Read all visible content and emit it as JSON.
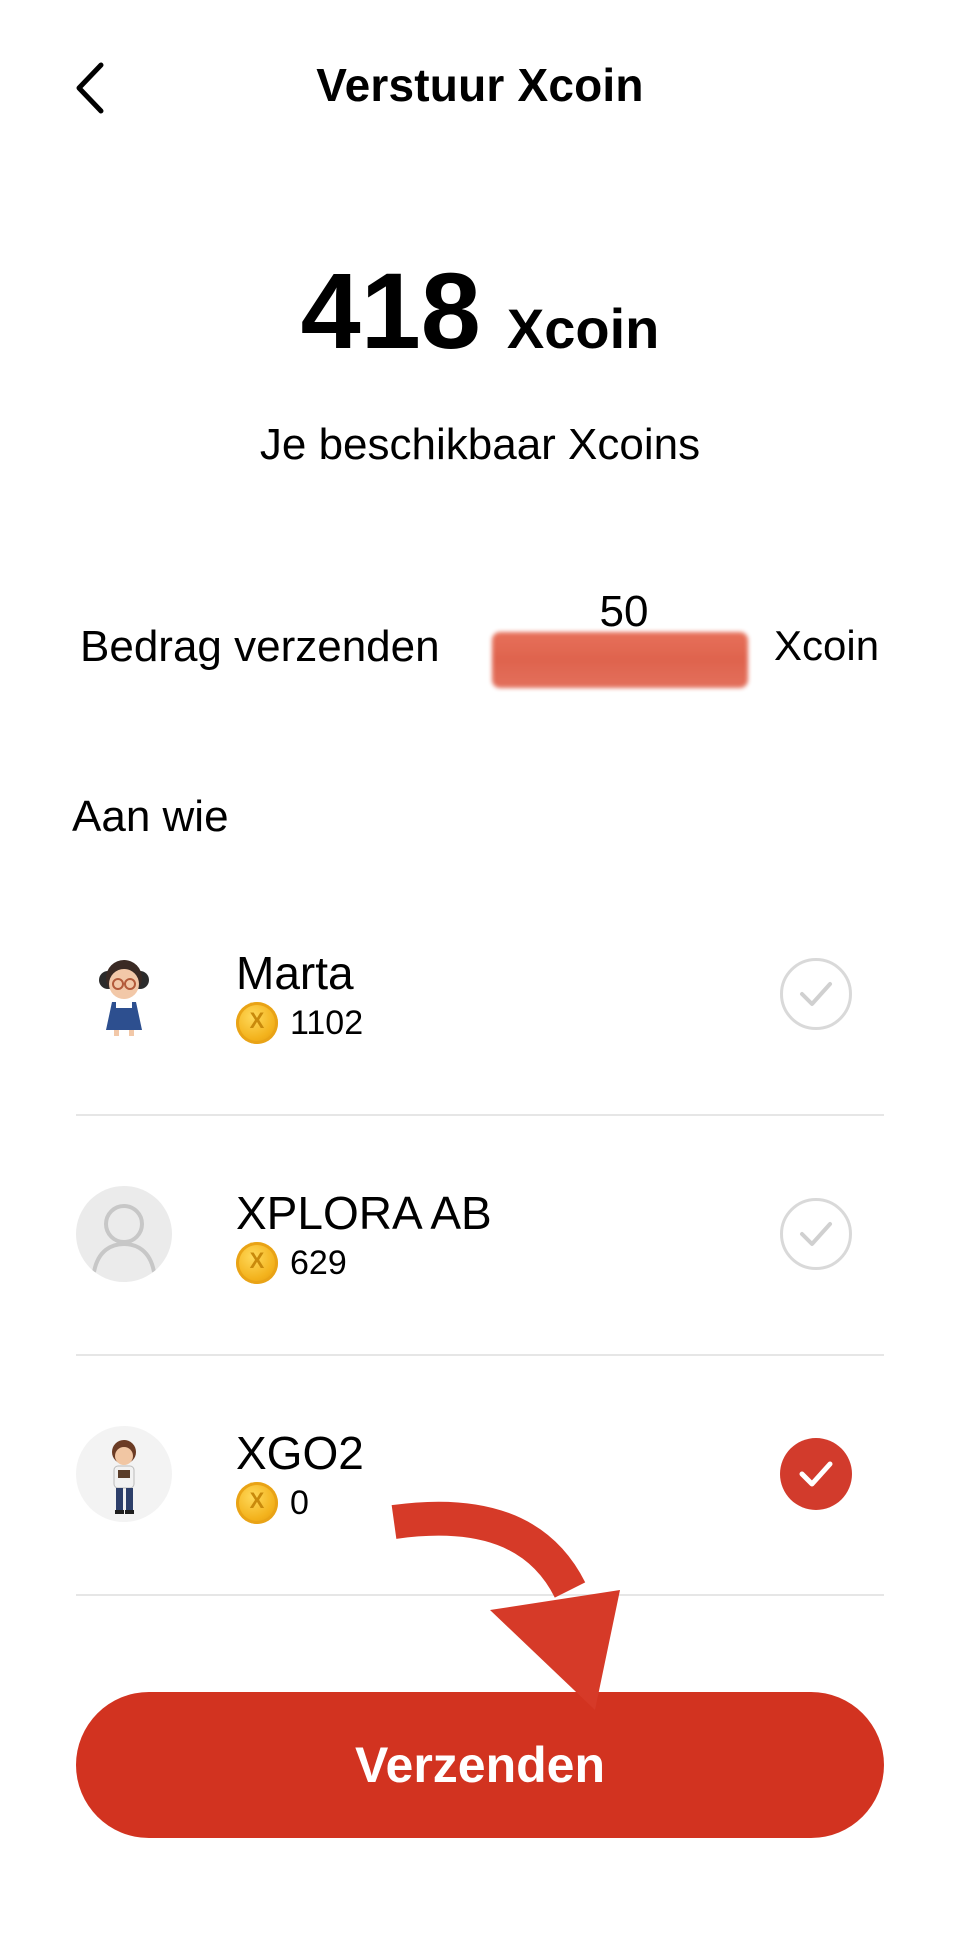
{
  "header": {
    "title": "Verstuur Xcoin"
  },
  "balance": {
    "amount": "418",
    "unit": "Xcoin",
    "subtitle": "Je beschikbaar Xcoins"
  },
  "send_amount": {
    "label": "Bedrag verzenden",
    "value": "50",
    "unit": "Xcoin"
  },
  "recipients": {
    "section_title": "Aan wie",
    "items": [
      {
        "name": "Marta",
        "coins": "1102",
        "selected": false,
        "avatar": "girl-character"
      },
      {
        "name": "XPLORA AB",
        "coins": "629",
        "selected": false,
        "avatar": "default-user"
      },
      {
        "name": "XGO2",
        "coins": "0",
        "selected": true,
        "avatar": "girl-character-2"
      }
    ]
  },
  "actions": {
    "send_label": "Verzenden"
  },
  "colors": {
    "accent": "#d23320",
    "check_selected": "#d23b2c",
    "divider": "#e6e6e6",
    "coin": "#f3b21c"
  }
}
